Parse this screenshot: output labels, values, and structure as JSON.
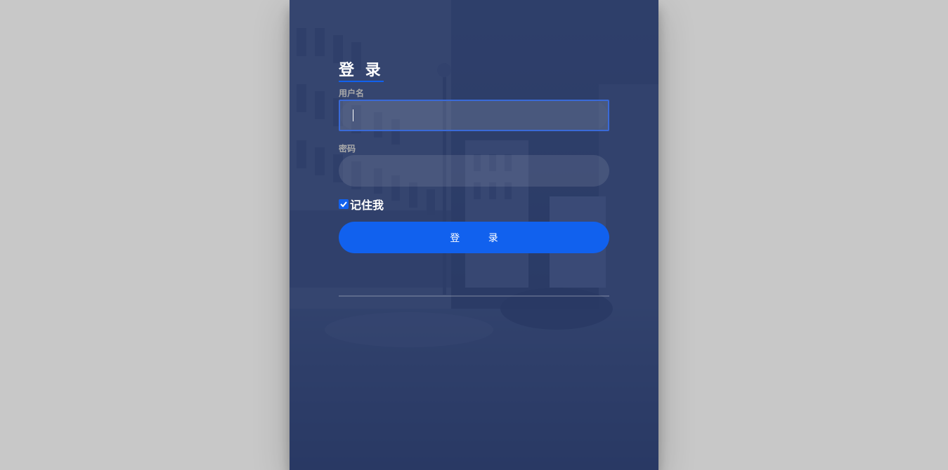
{
  "login": {
    "title": "登 录",
    "username_label": "用户名",
    "username_value": "",
    "password_label": "密码",
    "password_value": "",
    "remember_label": "记住我",
    "remember_checked": true,
    "submit_label": "登 录"
  },
  "colors": {
    "page_background": "#c8c8c8",
    "panel_overlay": "#283965",
    "accent": "#1161ee",
    "label_text": "#aaaaaa"
  },
  "icons": {
    "checkbox": "checkmark-icon"
  }
}
